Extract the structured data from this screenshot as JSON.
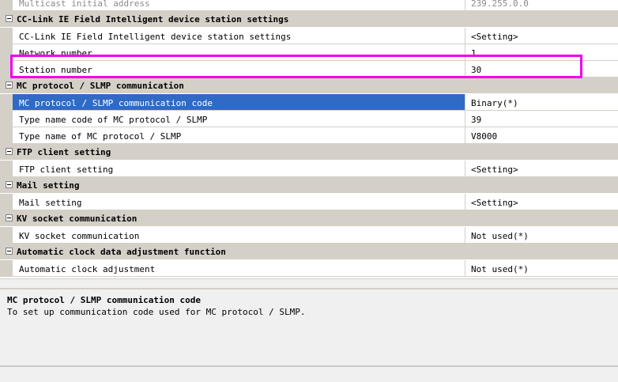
{
  "rows": [
    {
      "kind": "prop",
      "faded": true,
      "name": "Multicast initial address",
      "value": "239.255.0.0"
    },
    {
      "kind": "cat",
      "label": "CC-Link IE Field Intelligent device station settings"
    },
    {
      "kind": "prop",
      "name": "CC-Link IE Field Intelligent device station settings",
      "value": "<Setting>"
    },
    {
      "kind": "prop",
      "name": "Network number",
      "value": "1"
    },
    {
      "kind": "prop",
      "name": "Station number",
      "value": "30"
    },
    {
      "kind": "cat",
      "label": "MC protocol / SLMP communication"
    },
    {
      "kind": "prop",
      "selected": true,
      "name": "MC protocol / SLMP communication code",
      "value": "Binary(*)"
    },
    {
      "kind": "prop",
      "name": "Type name code of MC protocol / SLMP",
      "value": "39"
    },
    {
      "kind": "prop",
      "name": "Type name of MC protocol / SLMP",
      "value": "V8000"
    },
    {
      "kind": "cat",
      "label": "FTP client setting"
    },
    {
      "kind": "prop",
      "name": "FTP client setting",
      "value": "<Setting>"
    },
    {
      "kind": "cat",
      "label": "Mail setting"
    },
    {
      "kind": "prop",
      "name": "Mail setting",
      "value": "<Setting>"
    },
    {
      "kind": "cat",
      "label": "KV socket communication"
    },
    {
      "kind": "prop",
      "name": "KV socket communication",
      "value": "Not used(*)"
    },
    {
      "kind": "cat",
      "label": "Automatic clock data adjustment function"
    },
    {
      "kind": "prop",
      "name": "Automatic clock adjustment",
      "value": "Not used(*)"
    }
  ],
  "description": {
    "title": "MC protocol / SLMP communication code",
    "text": "To set up communication code used for MC protocol / SLMP."
  },
  "colors": {
    "highlight_box": "#ee00ee",
    "selection": "#316ac5",
    "category_band": "#d4d0c8"
  }
}
